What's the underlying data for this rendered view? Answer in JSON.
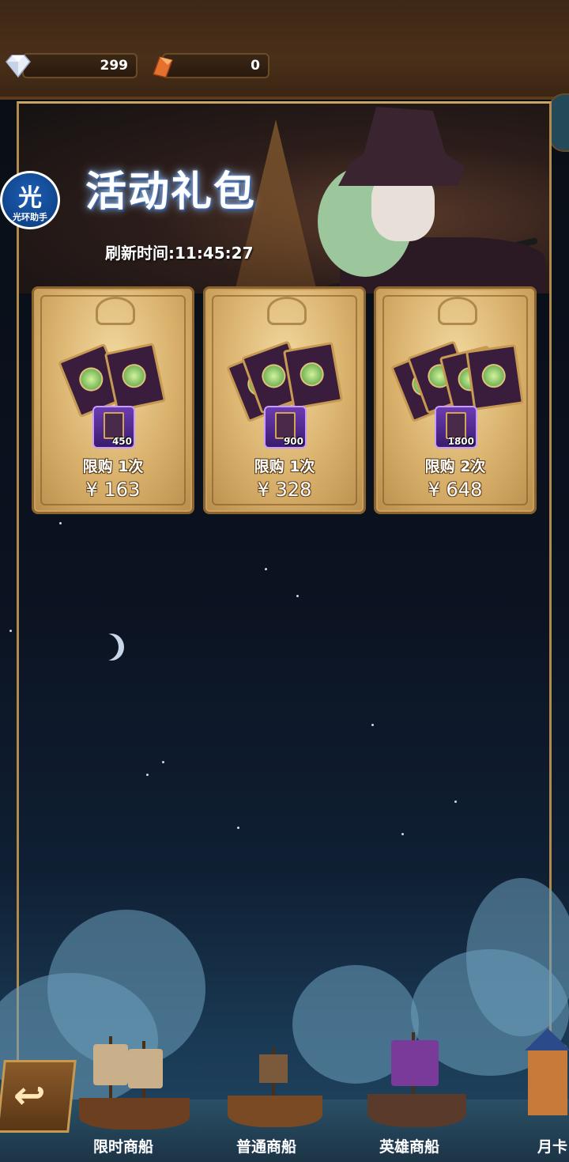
{
  "currency": {
    "diamonds": "299",
    "hero_essence": "0"
  },
  "assistant_badge": {
    "char": "光",
    "label": "光环助手"
  },
  "event": {
    "title": "活动礼包",
    "refresh": "刷新时间:11:45:27"
  },
  "packs": [
    {
      "qty": "450",
      "limit": "限购 1次",
      "price": "¥ 163"
    },
    {
      "qty": "900",
      "limit": "限购 1次",
      "price": "¥ 328"
    },
    {
      "qty": "1800",
      "limit": "限购 2次",
      "price": "¥ 648"
    }
  ],
  "ships": [
    {
      "label": "限时商船"
    },
    {
      "label": "普通商船"
    },
    {
      "label": "英雄商船"
    },
    {
      "label": "月卡"
    }
  ],
  "colors": {
    "panel_gold": "#b18a4e",
    "card_gold": "#d9b16c",
    "item_purple": "#6c3bb2"
  }
}
